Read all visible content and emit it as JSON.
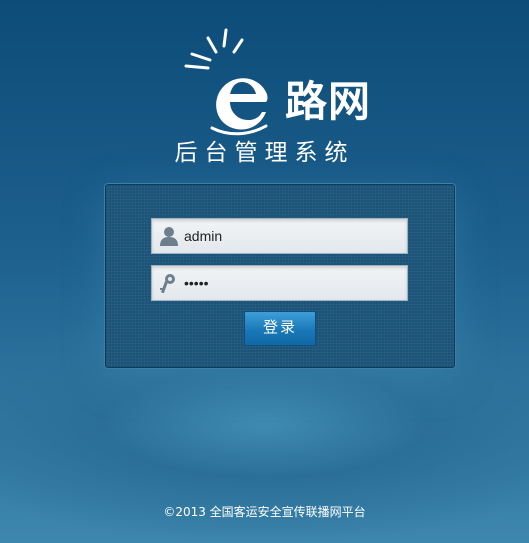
{
  "logo": {
    "brand_text": "路网"
  },
  "subtitle": "后台管理系统",
  "login_form": {
    "username_value": "admin",
    "password_value": "•••••",
    "submit_label": "登录"
  },
  "footer": {
    "copyright": "©2013 全国客运安全宣传联播网平台"
  },
  "icons": {
    "username": "user-icon",
    "password": "key-icon"
  },
  "colors": {
    "background_top": "#0d4c79",
    "background_bottom": "#3d86ae",
    "button": "#1a78b8"
  }
}
